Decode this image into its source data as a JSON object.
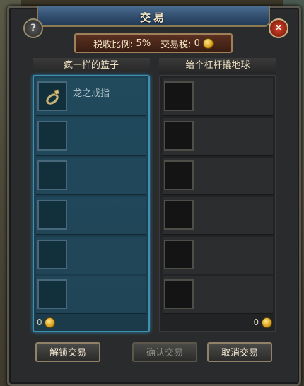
{
  "window": {
    "title": "交易"
  },
  "tax": {
    "rate_label": "税收比例:",
    "rate_value": "5%",
    "tax_label": "交易税:",
    "tax_value": "0"
  },
  "left_panel": {
    "player_name": "疯一样的篮子",
    "slots": [
      {
        "item_name": "龙之戒指",
        "icon": "ring-icon"
      },
      {
        "item_name": ""
      },
      {
        "item_name": ""
      },
      {
        "item_name": ""
      },
      {
        "item_name": ""
      },
      {
        "item_name": ""
      }
    ],
    "money": "0"
  },
  "right_panel": {
    "player_name": "给个杠杆撬地球",
    "slots": [
      {
        "item_name": ""
      },
      {
        "item_name": ""
      },
      {
        "item_name": ""
      },
      {
        "item_name": ""
      },
      {
        "item_name": ""
      },
      {
        "item_name": ""
      }
    ],
    "money": "0"
  },
  "buttons": {
    "unlock": "解锁交易",
    "confirm": "确认交易",
    "cancel": "取消交易"
  },
  "icons": {
    "help": "?",
    "close": "✕"
  },
  "colors": {
    "title_bar": "#2f4b6b",
    "left_highlight": "#3f8fb0",
    "tax_box": "#5b3122",
    "coin": "#d9a21b"
  }
}
